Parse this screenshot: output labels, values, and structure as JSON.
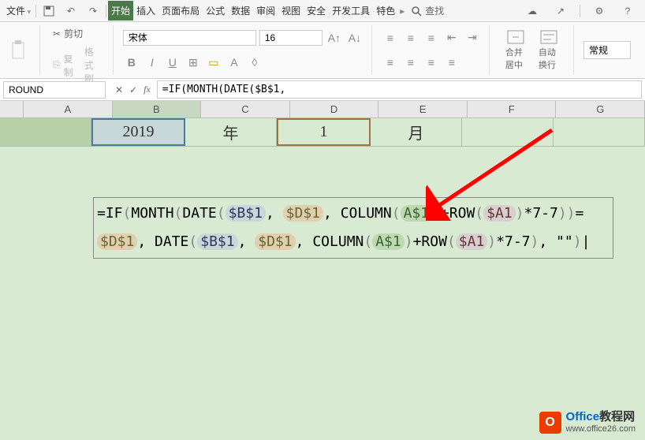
{
  "menu": {
    "file": "文件",
    "tabs": [
      "开始",
      "插入",
      "页面布局",
      "公式",
      "数据",
      "审阅",
      "视图",
      "安全",
      "开发工具",
      "特色"
    ],
    "active_tab": "开始",
    "search": "查找"
  },
  "ribbon": {
    "clipboard": {
      "cut": "剪切",
      "copy": "复制",
      "format_painter": "格式刷"
    },
    "font": {
      "name": "宋体",
      "size": "16"
    },
    "merge": "合并居中",
    "wrap": "自动换行",
    "number_format": "常规"
  },
  "formula_bar": {
    "name_box": "ROUND",
    "formula": "=IF(MONTH(DATE($B$1,"
  },
  "sheet": {
    "columns": [
      "A",
      "B",
      "C",
      "D",
      "E",
      "F",
      "G"
    ],
    "b1": "2019",
    "c1": "年",
    "d1": "1",
    "e1": "月",
    "formula_line1_prefix": "=IF",
    "formula_month": "MONTH",
    "formula_date": "DATE",
    "formula_column": "COLUMN",
    "formula_row": "ROW",
    "ref_b1": "$B$1",
    "ref_d1": "$D$1",
    "ref_a1": "A$1",
    "ref_a1r": "$A1",
    "tail1": "*7-7",
    "tail2": "=",
    "empty_str": "\"\""
  },
  "watermark": {
    "title_en": "Office",
    "title_cn": "教程网",
    "url": "www.office26.com"
  }
}
